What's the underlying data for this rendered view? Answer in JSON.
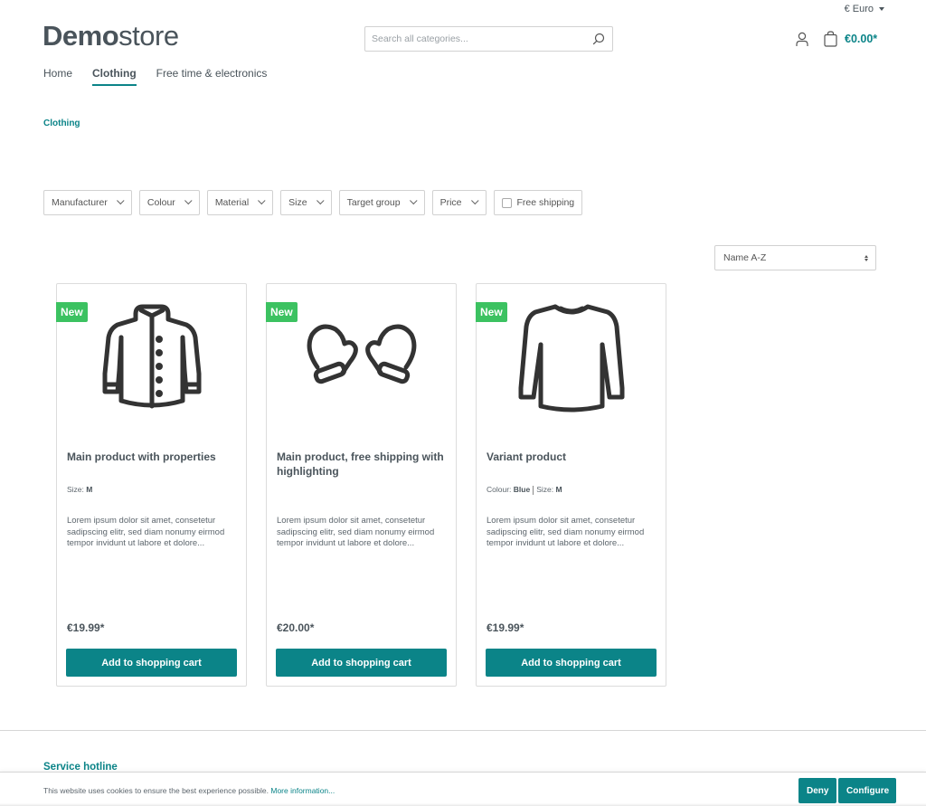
{
  "currency": {
    "label": "€ Euro",
    "icon": "caret-down-icon"
  },
  "logo": {
    "bold": "Demo",
    "light": "store"
  },
  "search": {
    "placeholder": "Search all categories...",
    "value": "",
    "icon": "search-icon"
  },
  "header": {
    "account_icon": "user-icon",
    "cart_icon": "shopping-bag-icon",
    "cart_total": "€0.00*"
  },
  "nav": {
    "items": [
      {
        "label": "Home",
        "active": false
      },
      {
        "label": "Clothing",
        "active": true
      },
      {
        "label": "Free time & electronics",
        "active": false
      }
    ]
  },
  "breadcrumb": {
    "current": "Clothing"
  },
  "filters": {
    "items": [
      {
        "label": "Manufacturer",
        "type": "dropdown"
      },
      {
        "label": "Colour",
        "type": "dropdown"
      },
      {
        "label": "Material",
        "type": "dropdown"
      },
      {
        "label": "Size",
        "type": "dropdown"
      },
      {
        "label": "Target group",
        "type": "dropdown"
      },
      {
        "label": "Price",
        "type": "dropdown"
      },
      {
        "label": "Free shipping",
        "type": "checkbox",
        "checked": false
      }
    ]
  },
  "sorting": {
    "selected": "Name A-Z"
  },
  "products": [
    {
      "badge": "New",
      "image_icon": "jacket-icon",
      "name": "Main product with properties",
      "props": [
        {
          "label": "Size:",
          "value": "M"
        }
      ],
      "description": "Lorem ipsum dolor sit amet, consetetur sadipscing elitr, sed diam nonumy eirmod tempor invidunt ut labore et dolore...",
      "price": "€19.99*",
      "button": "Add to shopping cart"
    },
    {
      "badge": "New",
      "image_icon": "mittens-icon",
      "name": "Main product, free shipping with highlighting",
      "props": [],
      "description": "Lorem ipsum dolor sit amet, consetetur sadipscing elitr, sed diam nonumy eirmod tempor invidunt ut labore et dolore...",
      "price": "€20.00*",
      "button": "Add to shopping cart"
    },
    {
      "badge": "New",
      "image_icon": "sweater-icon",
      "name": "Variant product",
      "props": [
        {
          "label": "Colour:",
          "value": "Blue"
        },
        {
          "label": "Size:",
          "value": "M"
        }
      ],
      "description": "Lorem ipsum dolor sit amet, consetetur sadipscing elitr, sed diam nonumy eirmod tempor invidunt ut labore et dolore...",
      "price": "€19.99*",
      "button": "Add to shopping cart"
    }
  ],
  "footer": {
    "hotline_title": "Service hotline"
  },
  "cookie": {
    "text": "This website uses cookies to ensure the best experience possible.",
    "link": "More information...",
    "deny": "Deny",
    "configure": "Configure"
  },
  "colors": {
    "brand": "#0b8488",
    "badge_new": "#3cc261",
    "text": "#4a545b",
    "border": "#d1d1d1"
  }
}
